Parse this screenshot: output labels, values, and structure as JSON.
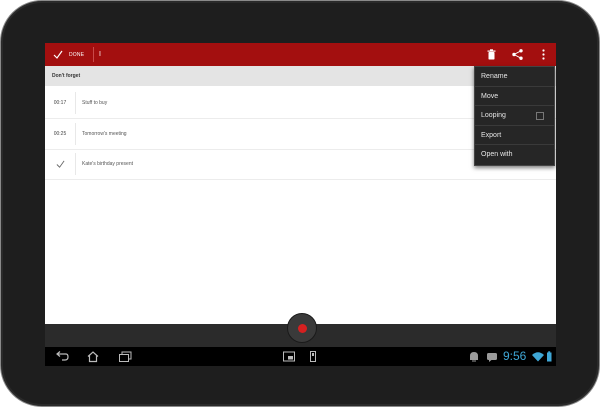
{
  "action_bar": {
    "done_label": "DONE",
    "title": "I",
    "background": "#a30f0f",
    "icons": [
      "checkmark-icon",
      "trash-icon",
      "share-icon",
      "overflow-menu-icon"
    ]
  },
  "list": {
    "section_header": "Don't forget",
    "items": [
      {
        "left": "00:17",
        "title": "Stuff to buy"
      },
      {
        "left": "00:25",
        "title": "Tomorrow's meeting"
      },
      {
        "left": "",
        "left_icon": "checkmark-icon",
        "title": "Kate's birthday present"
      }
    ]
  },
  "overflow_menu": {
    "items": [
      {
        "label": "Rename"
      },
      {
        "label": "Move"
      },
      {
        "label": "Looping",
        "checkbox": true,
        "checked": false
      },
      {
        "label": "Export"
      },
      {
        "label": "Open with"
      }
    ]
  },
  "recorder": {
    "record_icon": "record-icon",
    "record_color": "#d62020"
  },
  "system_bar": {
    "clock": "9:56",
    "clock_color": "#3fa7d6",
    "icons": [
      "back-icon",
      "home-icon",
      "recent-apps-icon",
      "screenshot-icon",
      "usb-icon",
      "android-debug-icon",
      "notification-icon",
      "wifi-icon",
      "battery-icon"
    ]
  }
}
